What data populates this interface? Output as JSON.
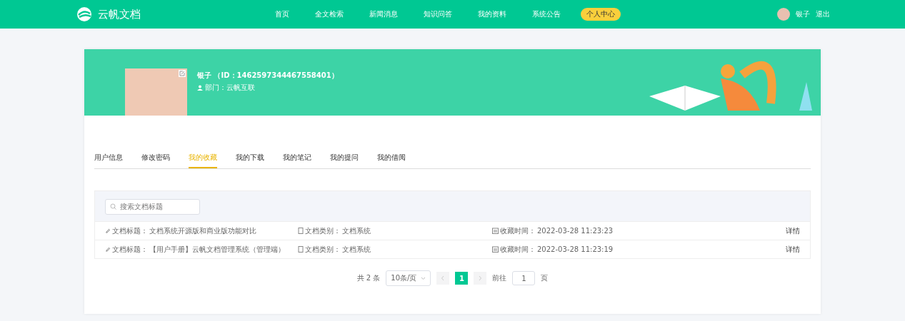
{
  "header": {
    "logo_text": "云帆文档",
    "nav": [
      {
        "label": "首页",
        "selected": false
      },
      {
        "label": "全文检索",
        "selected": false
      },
      {
        "label": "新闻消息",
        "selected": false
      },
      {
        "label": "知识问答",
        "selected": false
      },
      {
        "label": "我的资料",
        "selected": false
      },
      {
        "label": "系统公告",
        "selected": false
      },
      {
        "label": "个人中心",
        "selected": true
      }
    ],
    "user_name": "银子",
    "logout": "退出"
  },
  "profile": {
    "name_line": "银子 （ID：1462597344467558401）",
    "department": "部门：云帆互联"
  },
  "tabs": [
    {
      "label": "用户信息",
      "selected": false
    },
    {
      "label": "修改密码",
      "selected": false
    },
    {
      "label": "我的收藏",
      "selected": true
    },
    {
      "label": "我的下载",
      "selected": false
    },
    {
      "label": "我的笔记",
      "selected": false
    },
    {
      "label": "我的提问",
      "selected": false
    },
    {
      "label": "我的借阅",
      "selected": false
    }
  ],
  "search": {
    "placeholder": "搜索文档标题"
  },
  "rows": [
    {
      "title_label": "文档标题：",
      "title": "文档系统开源版和商业版功能对比",
      "category_label": "文档类别：",
      "category": "文档系统",
      "time_label": "收藏时间：",
      "time": "2022-03-28 11:23:23",
      "action": "详情"
    },
    {
      "title_label": "文档标题：",
      "title": "【用户手册】云帆文档管理系统（管理端）",
      "category_label": "文档类别：",
      "category": "文档系统",
      "time_label": "收藏时间：",
      "time": "2022-03-28 11:23:19",
      "action": "详情"
    }
  ],
  "pagination": {
    "total": "共 2 条",
    "page_size": "10条/页",
    "pages": [
      {
        "label": "1",
        "selected": true
      }
    ],
    "goto_label": "前往",
    "goto_value": "1",
    "goto_suffix": "页"
  }
}
